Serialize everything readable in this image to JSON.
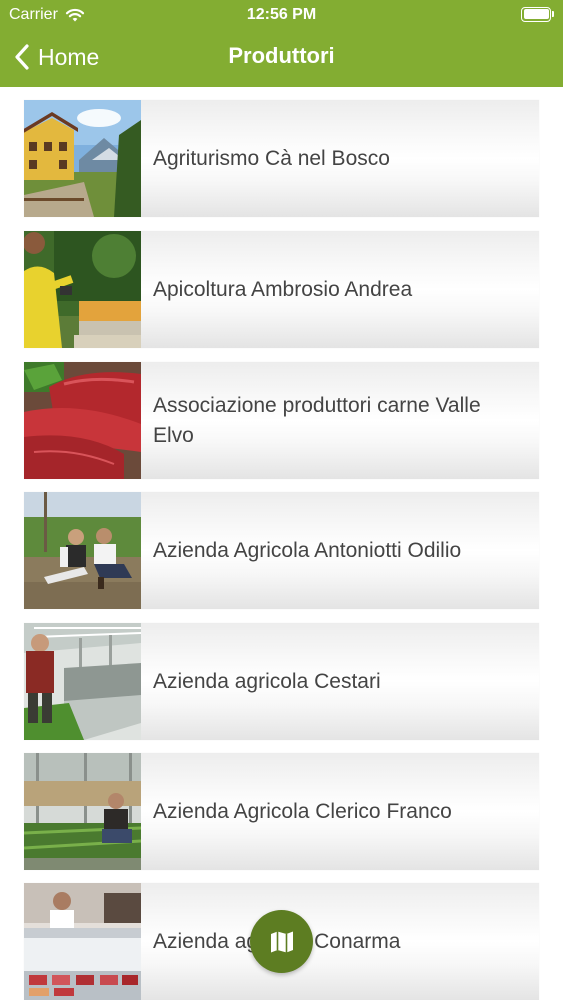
{
  "status_bar": {
    "carrier": "Carrier",
    "time": "12:56 PM"
  },
  "nav": {
    "back_label": "Home",
    "title": "Produttori"
  },
  "producers": [
    {
      "name": "Agriturismo Cà nel Bosco",
      "image": "farmhouse-photo"
    },
    {
      "name": "Apicoltura Ambrosio Andrea",
      "image": "beekeeper-photo"
    },
    {
      "name": "Associazione produttori carne Valle Elvo",
      "image": "raw-meat-photo"
    },
    {
      "name": "Azienda Agricola Antoniotti Odilio",
      "image": "farmers-on-grass-photo"
    },
    {
      "name": "Azienda agricola Cestari",
      "image": "greenhouse-farmer-photo"
    },
    {
      "name": "Azienda Agricola Clerico Franco",
      "image": "greenhouse-kneeling-photo"
    },
    {
      "name": "Azienda agricola Conarma",
      "image": "butcher-shop-photo"
    }
  ],
  "fab": {
    "icon": "map-icon"
  },
  "colors": {
    "header": "#83ad32",
    "fab": "#5d7d22",
    "text": "#444444"
  }
}
